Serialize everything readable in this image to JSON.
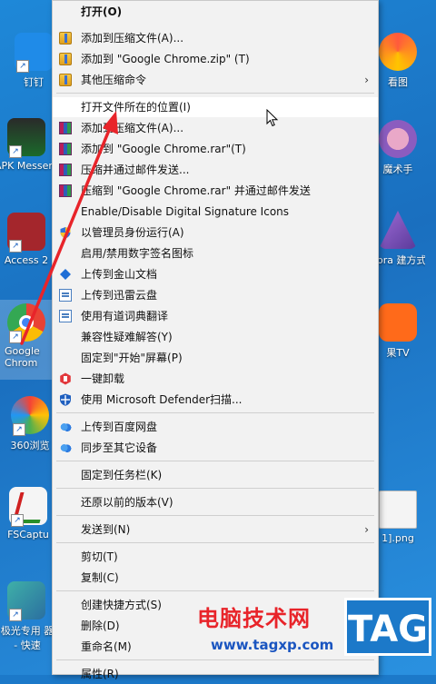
{
  "desktop": {
    "icons_left": [
      {
        "label": "钉钉",
        "color": "#2d8cf0"
      },
      {
        "label": "APK Messeng",
        "color": "#1f8f3a"
      },
      {
        "label": "Access 2",
        "color": "#a4262c"
      },
      {
        "label": "Google Chrom",
        "color": "#e94235"
      },
      {
        "label": "360浏览",
        "color": "#4caf50"
      },
      {
        "label": "FSCaptu",
        "color": "#d02020"
      },
      {
        "label": "极光专用 器 - 快速",
        "color": "#2a8f8f"
      }
    ],
    "icons_right": [
      {
        "label": "看图"
      },
      {
        "label": "魔术手"
      },
      {
        "label": "ebra 建方式"
      },
      {
        "label": "果TV"
      },
      {
        "label": "1].png"
      }
    ]
  },
  "menu": {
    "items": [
      {
        "label": "打开(O)",
        "icon": "none"
      },
      {
        "label": "添加到压缩文件(A)...",
        "icon": "zip-icon"
      },
      {
        "label": "添加到 \"Google Chrome.zip\" (T)",
        "icon": "zip-icon"
      },
      {
        "label": "其他压缩命令",
        "icon": "zip-icon"
      },
      {
        "label": "打开文件所在的位置(I)",
        "icon": "none"
      },
      {
        "label": "添加到压缩文件(A)...",
        "icon": "rar-icon"
      },
      {
        "label": "添加到 \"Google Chrome.rar\"(T)",
        "icon": "rar-icon"
      },
      {
        "label": "压缩并通过邮件发送...",
        "icon": "rar-icon"
      },
      {
        "label": "压缩到 \"Google Chrome.rar\" 并通过邮件发送",
        "icon": "rar-icon"
      },
      {
        "label": "Enable/Disable Digital Signature Icons",
        "icon": "none"
      },
      {
        "label": "以管理员身份运行(A)",
        "icon": "uac-shield-icon"
      },
      {
        "label": "启用/禁用数字签名图标",
        "icon": "none"
      },
      {
        "label": "上传到金山文档",
        "icon": "kdocs-icon"
      },
      {
        "label": "上传到迅雷云盘",
        "icon": "frame-icon"
      },
      {
        "label": "使用有道词典翻译",
        "icon": "frame-icon"
      },
      {
        "label": "兼容性疑难解答(Y)",
        "icon": "none"
      },
      {
        "label": "固定到\"开始\"屏幕(P)",
        "icon": "none"
      },
      {
        "label": "一键卸载",
        "icon": "uninstall-icon"
      },
      {
        "label": "使用 Microsoft Defender扫描...",
        "icon": "defender-icon"
      },
      {
        "label": "上传到百度网盘",
        "icon": "baidu-cloud-icon"
      },
      {
        "label": "同步至其它设备",
        "icon": "baidu-cloud-icon"
      },
      {
        "label": "固定到任务栏(K)",
        "icon": "none"
      },
      {
        "label": "还原以前的版本(V)",
        "icon": "none"
      },
      {
        "label": "发送到(N)",
        "icon": "none"
      },
      {
        "label": "剪切(T)",
        "icon": "none"
      },
      {
        "label": "复制(C)",
        "icon": "none"
      },
      {
        "label": "创建快捷方式(S)",
        "icon": "none"
      },
      {
        "label": "删除(D)",
        "icon": "none"
      },
      {
        "label": "重命名(M)",
        "icon": "none"
      },
      {
        "label": "属性(R)",
        "icon": "none"
      }
    ],
    "submenu_arrow": "›"
  },
  "watermark": {
    "site_name": "电脑技术网",
    "url": "www.tagxp.com",
    "badge": "TAG"
  },
  "colors": {
    "highlight_arrow": "#e8242a",
    "menu_bg": "#f2f2f2",
    "desktop_bg": "#1c79c9"
  }
}
